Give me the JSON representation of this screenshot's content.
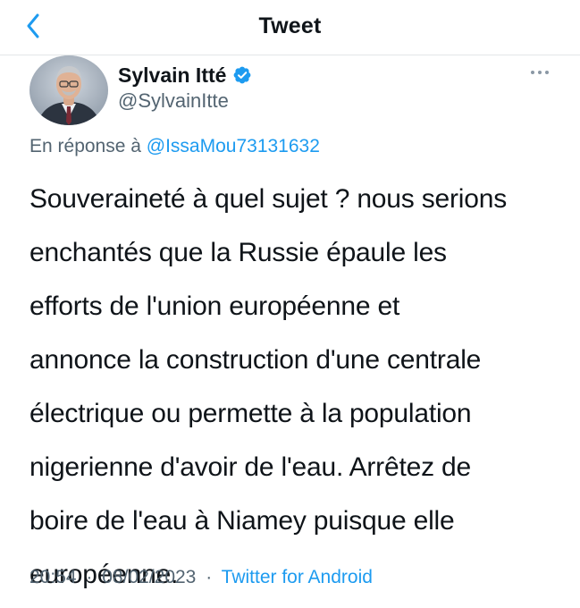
{
  "header": {
    "title": "Tweet",
    "back_icon": "chevron-left-icon",
    "accent": "#1d9bf0"
  },
  "author": {
    "name": "Sylvain Itté",
    "handle": "@SylvainItte",
    "verified": true,
    "verified_icon": "verified-badge-icon",
    "avatar_icon": "avatar-photo"
  },
  "reply": {
    "prefix": "En réponse à",
    "mention": "@IssaMou73131632"
  },
  "tweet": {
    "text": "Souveraineté à quel sujet ? nous serions\nenchantés que la Russie épaule les\nefforts de l'union européenne et\nannonce la construction d'une centrale\nélectrique ou permette à la population\nnigerienne d'avoir de l'eau. Arrêtez de\nboire de l'eau à Niamey puisque elle\neuropéenne."
  },
  "meta": {
    "time": "20:54",
    "separator": "·",
    "date": "08/02/2023",
    "source": "Twitter for Android"
  },
  "more_icon": "more-dots-icon"
}
